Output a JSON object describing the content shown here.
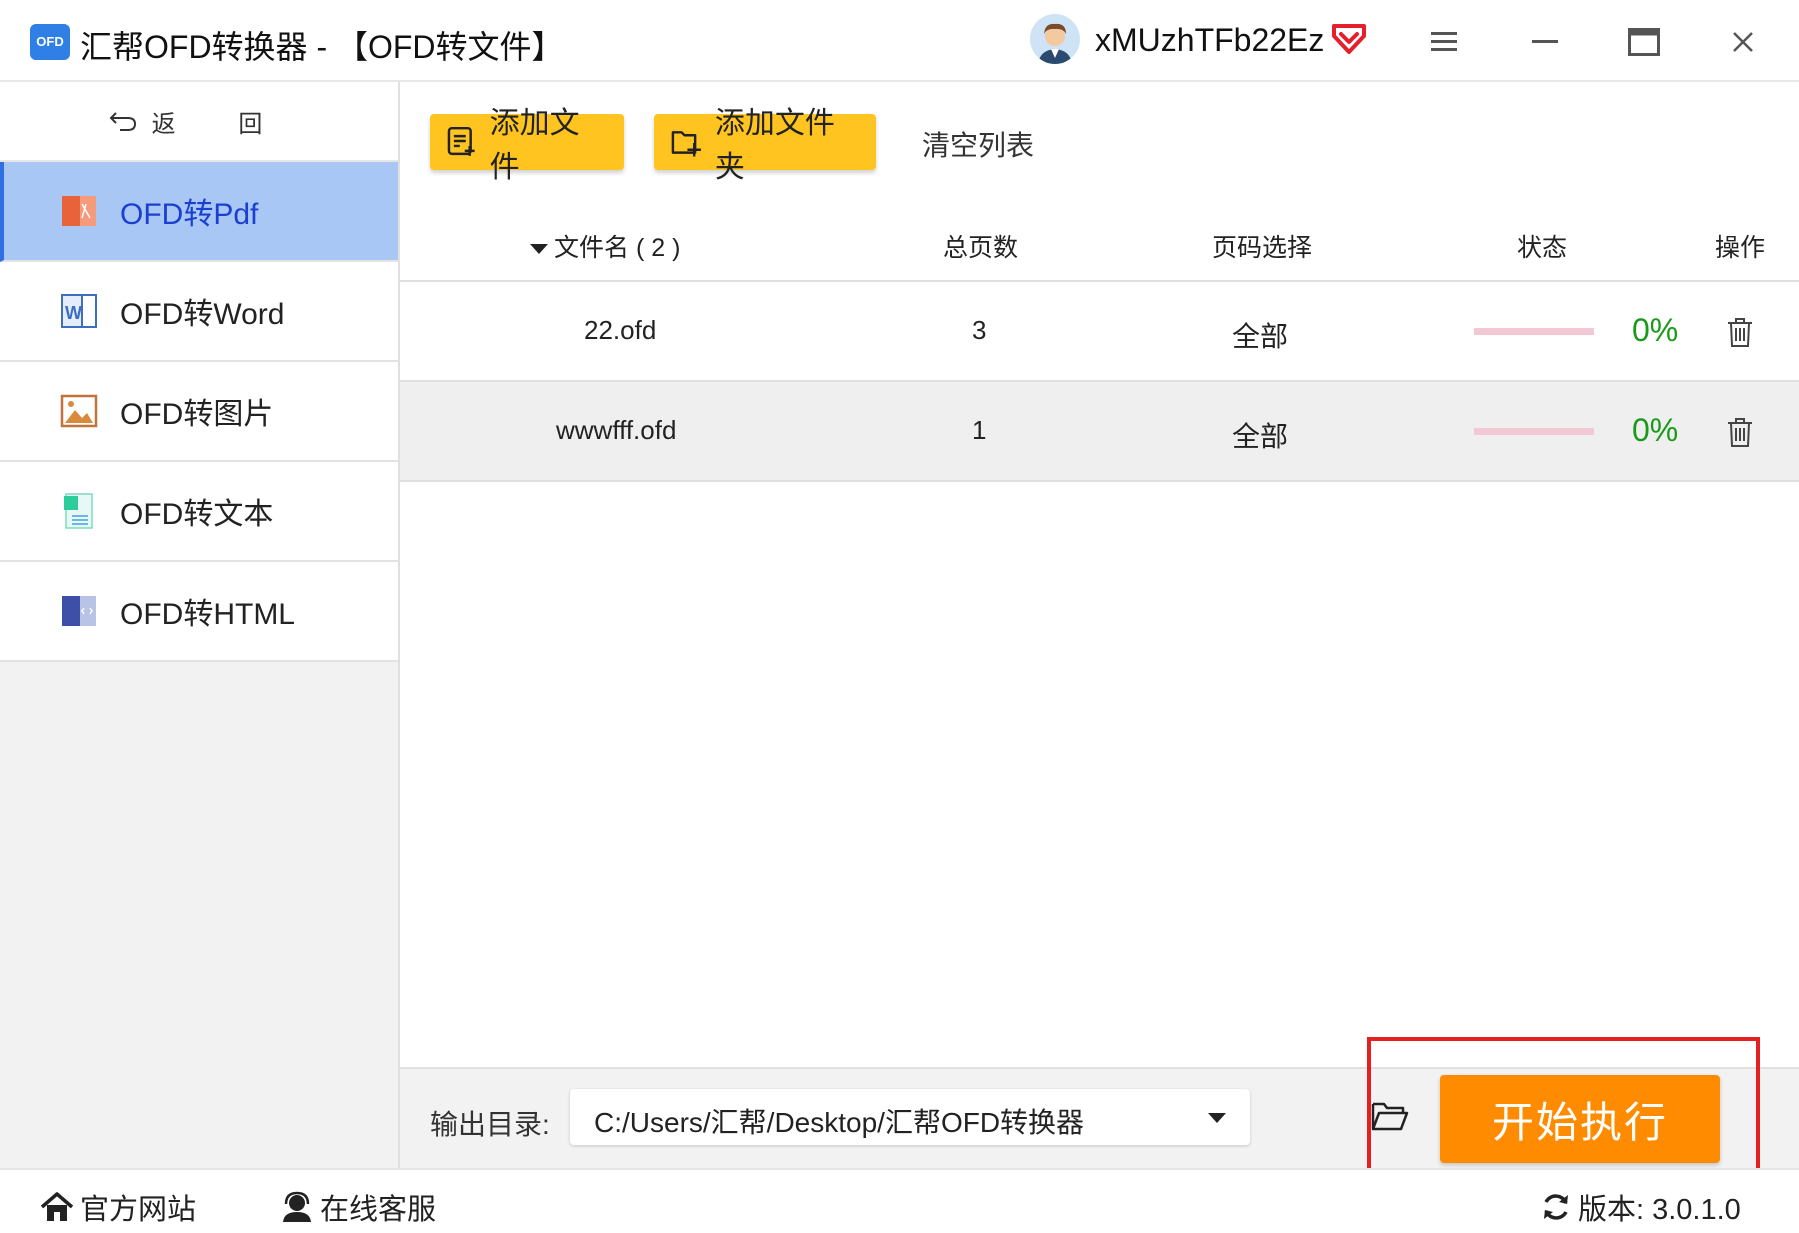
{
  "window": {
    "logo_text": "OFD",
    "title": "汇帮OFD转换器 - 【OFD转文件】",
    "username": "xMUzhTFb22Ez"
  },
  "sidebar": {
    "back_label": "返 回",
    "items": [
      {
        "label": "OFD转Pdf",
        "icon": "pdf-icon",
        "active": true
      },
      {
        "label": "OFD转Word",
        "icon": "word-icon",
        "active": false
      },
      {
        "label": "OFD转图片",
        "icon": "image-icon",
        "active": false
      },
      {
        "label": "OFD转文本",
        "icon": "text-icon",
        "active": false
      },
      {
        "label": "OFD转HTML",
        "icon": "html-icon",
        "active": false
      }
    ]
  },
  "toolbar": {
    "add_file": "添加文件",
    "add_folder": "添加文件夹",
    "clear_list": "清空列表"
  },
  "table": {
    "headers": {
      "filename": "文件名 ( 2 )",
      "pages": "总页数",
      "page_select": "页码选择",
      "status": "状态",
      "action": "操作"
    },
    "rows": [
      {
        "filename": "22.ofd",
        "pages": "3",
        "page_select": "全部",
        "progress": 0,
        "percent": "0%"
      },
      {
        "filename": "wwwfff.ofd",
        "pages": "1",
        "page_select": "全部",
        "progress": 0,
        "percent": "0%"
      }
    ]
  },
  "output": {
    "label": "输出目录:",
    "path": "C:/Users/汇帮/Desktop/汇帮OFD转换器",
    "start_button": "开始执行"
  },
  "footer": {
    "website": "官方网站",
    "support": "在线客服",
    "version": "版本: 3.0.1.0"
  },
  "colors": {
    "accent_yellow": "#ffc41f",
    "start_orange": "#ff8c00",
    "active_nav_bg": "#a9c7f5",
    "active_nav_text": "#1a3fd1",
    "percent_green": "#1a9a1a",
    "highlight_red": "#e52020"
  }
}
